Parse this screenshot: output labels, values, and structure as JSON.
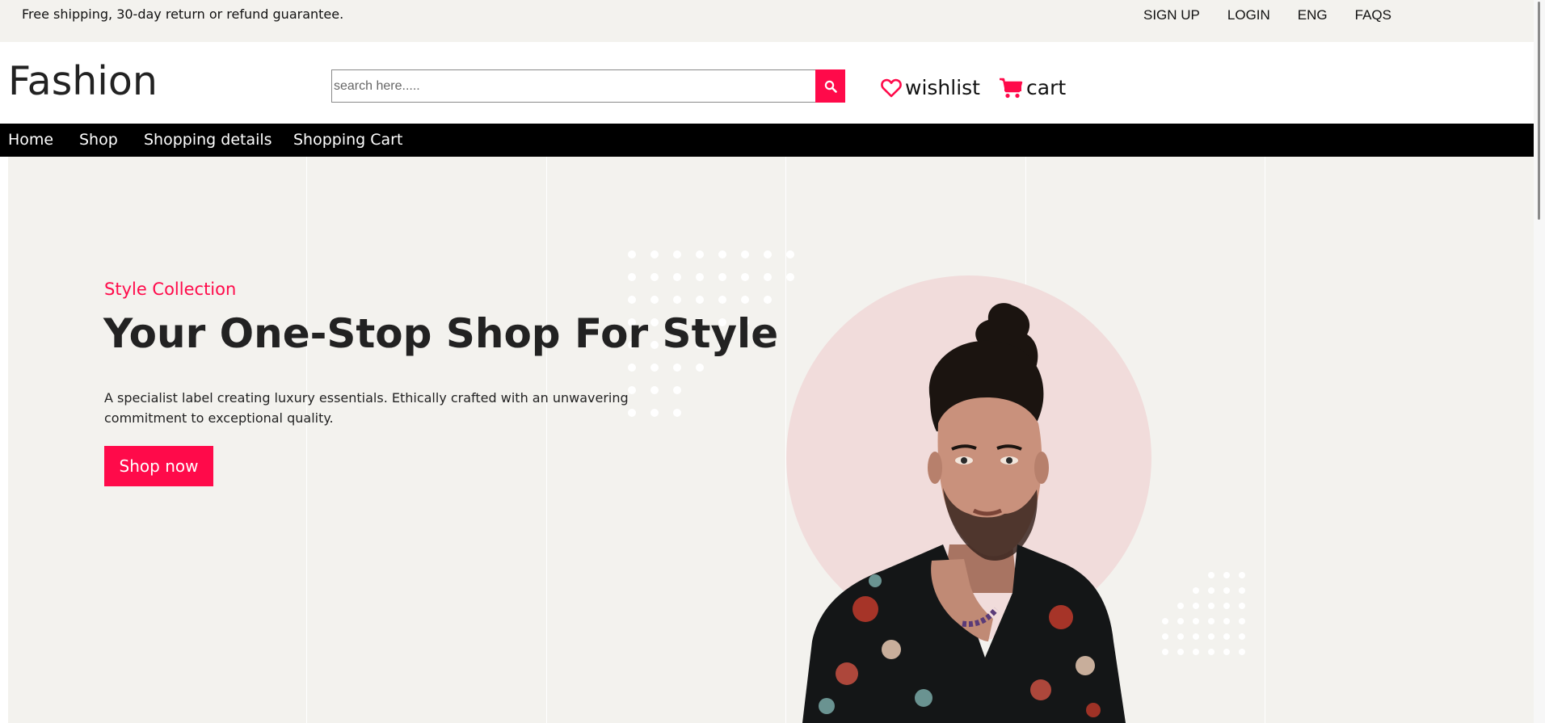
{
  "topbar": {
    "promo": "Free shipping, 30-day return or refund guarantee.",
    "links": [
      "SIGN UP",
      "LOGIN",
      "ENG",
      "FAQS"
    ]
  },
  "header": {
    "logo": "Fashion",
    "search": {
      "placeholder": "search here.....",
      "value": ""
    },
    "wishlist_label": "wishlist",
    "cart_label": "cart"
  },
  "nav": {
    "items": [
      "Home",
      "Shop",
      "Shopping details",
      "Shopping Cart"
    ]
  },
  "hero": {
    "eyebrow": "Style Collection",
    "headline": "Your One-Stop Shop For Style",
    "description": "A specialist label creating luxury essentials. Ethically crafted with an unwavering commitment to exceptional quality.",
    "cta": "Shop now"
  },
  "colors": {
    "accent": "#ff0a4a",
    "nav_background": "#000000",
    "hero_background": "#f3f2ee",
    "circle": "#f1dcdb"
  },
  "icons": [
    "search-icon",
    "heart-icon",
    "cart-icon"
  ]
}
